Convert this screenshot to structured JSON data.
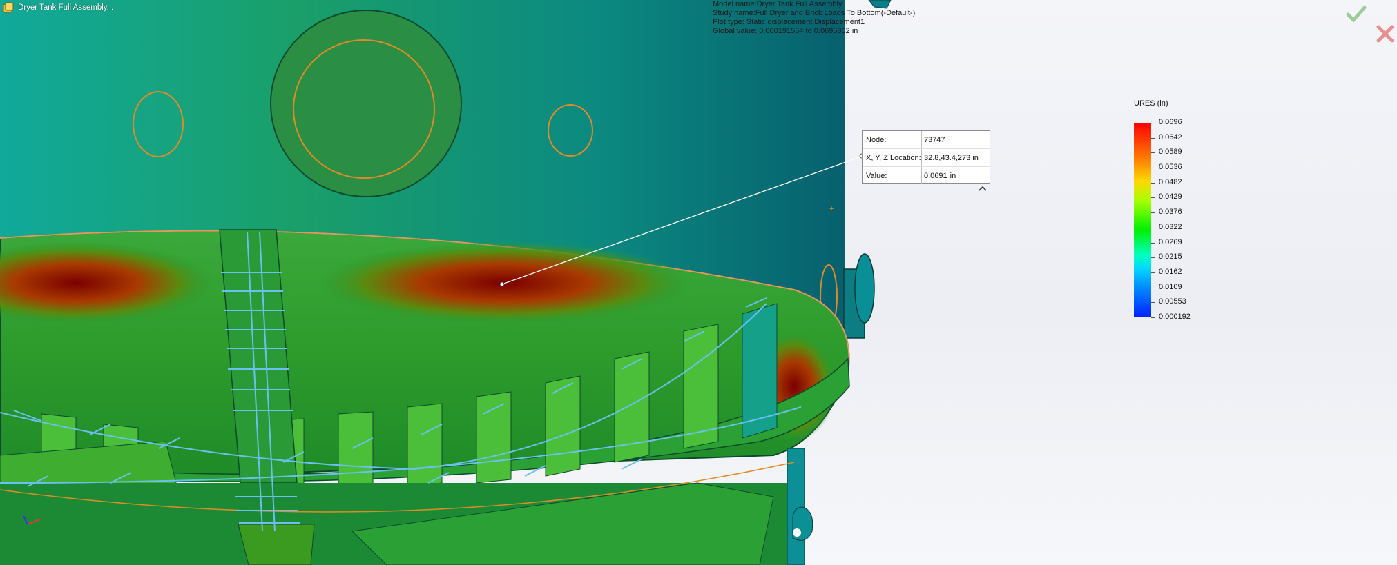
{
  "window": {
    "title": "Dryer Tank Full Assembly..."
  },
  "study_info": {
    "model_name": "Model name:Dryer Tank Full Assembly",
    "study_name": "Study name:Full Dryer and Brick Loads To Bottom(-Default-)",
    "plot_type": "Plot type: Static displacement Displacement1",
    "global_value": "Global value: 0.000191554 to 0.0695852 in"
  },
  "probe": {
    "node_label": "Node:",
    "node_value": "73747",
    "loc_label": "X, Y, Z Location:",
    "loc_value": "32.8,43.4,273 in",
    "value_label": "Value:",
    "value_value": "0.0691",
    "value_unit": "in"
  },
  "legend": {
    "title": "URES (in)",
    "ticks": [
      "0.0696",
      "0.0642",
      "0.0589",
      "0.0536",
      "0.0482",
      "0.0429",
      "0.0376",
      "0.0322",
      "0.0269",
      "0.0215",
      "0.0162",
      "0.0109",
      "0.00553",
      "0.000192"
    ]
  },
  "icons": {
    "ok": "checkmark-icon",
    "cancel": "close-icon",
    "doc": "assembly-doc-icon",
    "collapse": "chevron-up-icon"
  },
  "colors": {
    "max": "#ff0000",
    "min": "#0020ff",
    "tank_shell": "#0f8a84"
  }
}
